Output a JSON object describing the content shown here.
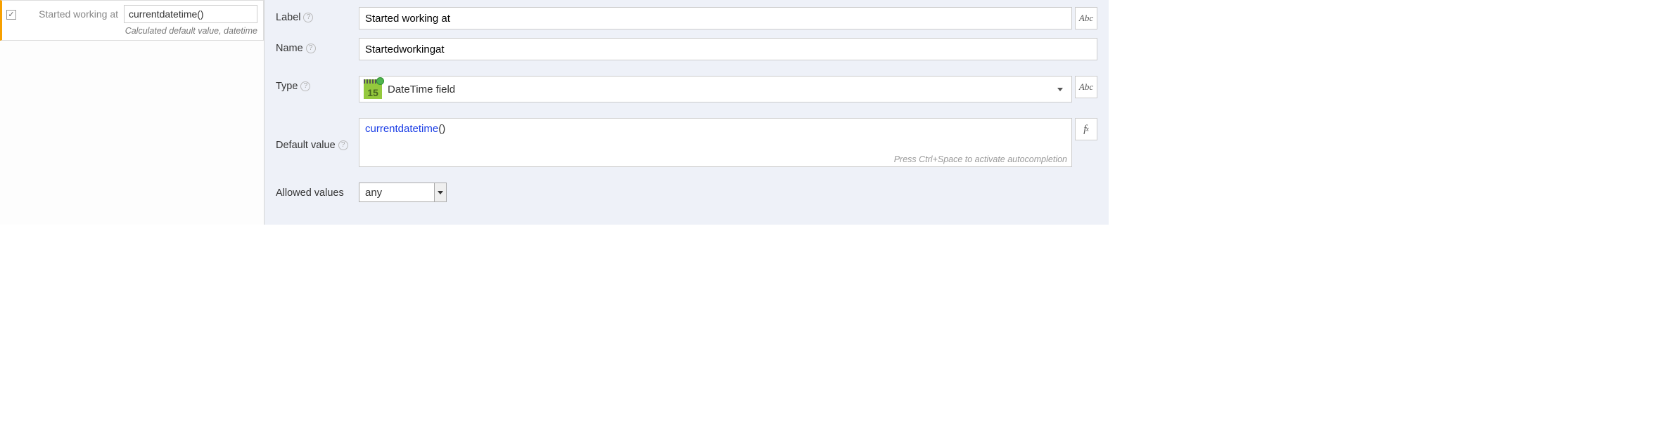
{
  "left": {
    "field_label": "Started working at",
    "field_value": "currentdatetime()",
    "subtext": "Calculated default value, datetime",
    "checked": true
  },
  "right": {
    "label": {
      "caption": "Label",
      "value": "Started working at",
      "side_btn": "Abc"
    },
    "name": {
      "caption": "Name",
      "value": "Startedworkingat"
    },
    "type": {
      "caption": "Type",
      "value": "DateTime field",
      "icon_day": "15",
      "side_btn": "Abc"
    },
    "default_value": {
      "caption": "Default value",
      "func": "currentdatetime",
      "parens": "()",
      "hint": "Press Ctrl+Space to activate autocompletion"
    },
    "allowed_values": {
      "caption": "Allowed values",
      "value": "any"
    }
  }
}
